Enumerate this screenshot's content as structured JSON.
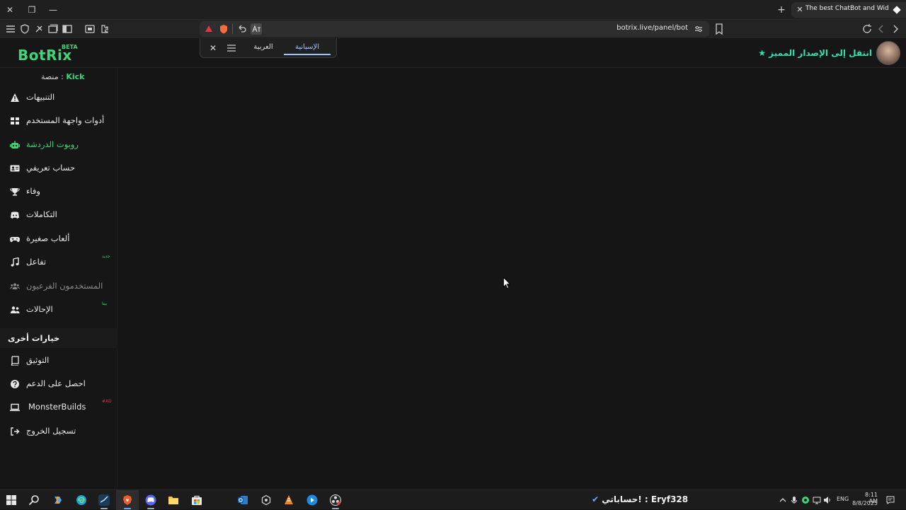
{
  "browser": {
    "tab": {
      "title": "The best ChatBot and Widgets fo"
    },
    "address": {
      "url": "botrix.live/panel/bot"
    }
  },
  "translate": {
    "languages": [
      {
        "label": "العربية"
      },
      {
        "label": "الإسبانية"
      }
    ],
    "active_language": "الإسبانية"
  },
  "header": {
    "logo": "BotRix",
    "logo_badge": "BETA",
    "premium_link": "انتقل إلى الإصدار المميز"
  },
  "sidebar": {
    "platform_label": "منصة :",
    "platform_name": "Kick",
    "items": [
      {
        "label": "التنبيهات",
        "icon": "warning-icon"
      },
      {
        "label": "أدوات واجهة المستخدم",
        "icon": "widgets-grid-icon"
      },
      {
        "label": "روبوت الدردشة",
        "icon": "robot-icon",
        "active": true
      },
      {
        "label": "حساب تعريفي",
        "icon": "id-card-icon"
      },
      {
        "label": "وفاء",
        "icon": "trophy-icon"
      },
      {
        "label": "التكاملات",
        "icon": "discord-icon"
      },
      {
        "label": "ألعاب صغيرة",
        "icon": "gamepad-icon"
      },
      {
        "label": "تفاعل",
        "icon": "music-note-icon",
        "badge": "جديد"
      },
      {
        "label": "المستخدمون الفرعيون",
        "icon": "users-group-icon",
        "disabled": true
      },
      {
        "label": "الإحالات",
        "icon": "user-friends-icon",
        "badge": "بيتا"
      }
    ],
    "other_options_title": "خيارات أخرى",
    "other_items": [
      {
        "label": "التوثيق",
        "icon": "book-icon"
      },
      {
        "label": "احصل على الدعم",
        "icon": "question-icon"
      },
      {
        "label": "MonsterBuilds",
        "icon": "laptop-icon",
        "badge": "#AD"
      },
      {
        "label": "تسجيل الخروج",
        "icon": "logout-icon"
      }
    ]
  },
  "taskbar": {
    "now_playing": "حساباتي! : Eryf328",
    "language": "ENG",
    "time": "8:11 AM",
    "date": "8/8/2025"
  },
  "colors": {
    "accent_green": "#3ed678",
    "premium_teal": "#2fe0b0",
    "background": "#141414"
  }
}
